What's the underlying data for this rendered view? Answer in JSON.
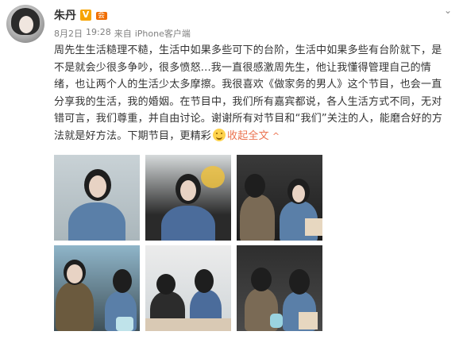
{
  "user": {
    "name": "朱丹",
    "verified_badge": "V",
    "vip_badge": "会"
  },
  "post": {
    "date": "8月2日",
    "time": "19:28",
    "source_prefix": "来自",
    "source": "iPhone客户端",
    "text": "周先生生活糙理不糙，生活中如果多些可下的台阶，生活中如果多些有台阶就下，是不是就会少很多争吵，很多愤怒...我一直很感激周先生，他让我懂得管理自己的情绪，也让两个人的生活少太多摩擦。我很喜欢《做家务的男人》这个节目，也会一直分享我的生活，我的婚姻。在节目中，我们所有嘉宾都说，各人生活方式不同，无对错可言，我们尊重，并自由讨论。谢谢所有对节目和“我们”关注的人，能磨合好的方法就是好方法。下期节目，更精彩",
    "collapse_label": "收起全文",
    "collapse_icon": "^"
  },
  "header": {
    "menu_icon": "⌄"
  },
  "photos": [
    {
      "label": "photo-1"
    },
    {
      "label": "photo-2"
    },
    {
      "label": "photo-3"
    },
    {
      "label": "photo-4"
    },
    {
      "label": "photo-5"
    },
    {
      "label": "photo-6"
    }
  ],
  "colors": {
    "link": "#eb7350",
    "meta": "#808080",
    "badge": "#f7a400"
  }
}
